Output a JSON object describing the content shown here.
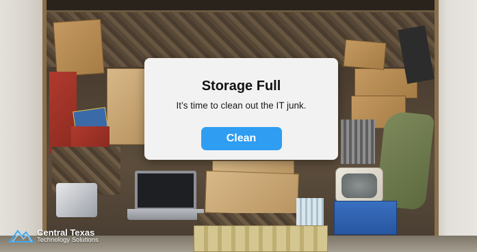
{
  "dialog": {
    "title": "Storage Full",
    "message": "It’s time to clean out the IT junk.",
    "button_label": "Clean"
  },
  "branding": {
    "company_name": "Central Texas",
    "company_tagline": "Technology Solutions"
  },
  "colors": {
    "button_bg": "#2e9df2",
    "dialog_bg": "#f2f2f2"
  }
}
